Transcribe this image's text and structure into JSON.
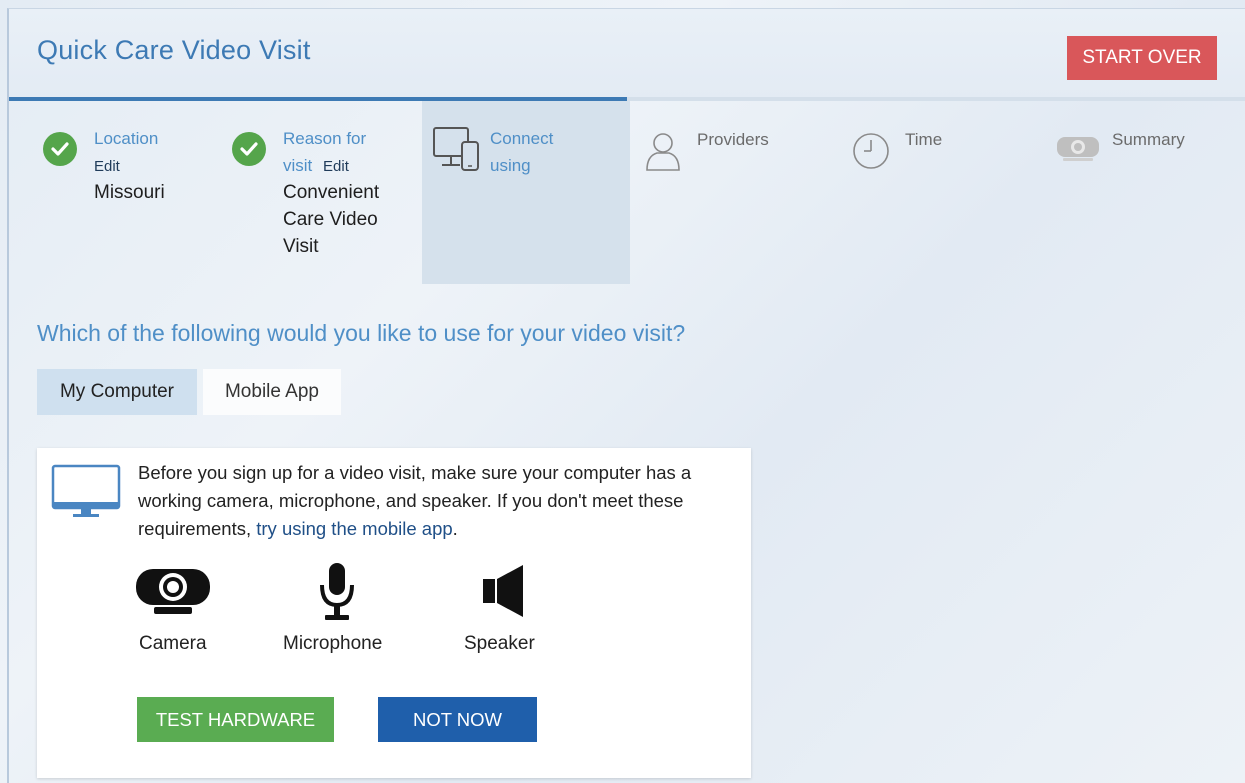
{
  "app": {
    "title": "Quick Care Video Visit",
    "start_over_label": "START OVER"
  },
  "progress": {
    "completed_fraction": 0.5
  },
  "steps": [
    {
      "title": "Location",
      "edit": "Edit",
      "value": "Missouri",
      "status": "complete",
      "icon": "check-icon"
    },
    {
      "title_line1": "Reason for",
      "title_line2": "visit",
      "edit": "Edit",
      "value_lines": [
        "Convenient",
        "Care Video",
        "Visit"
      ],
      "status": "complete",
      "icon": "check-icon"
    },
    {
      "title_line1": "Connect",
      "title_line2": "using",
      "status": "active",
      "icon": "devices-icon"
    },
    {
      "title": "Providers",
      "status": "pending",
      "icon": "person-icon"
    },
    {
      "title": "Time",
      "status": "pending",
      "icon": "clock-icon"
    },
    {
      "title": "Summary",
      "status": "pending",
      "icon": "camera-icon"
    }
  ],
  "question": "Which of the following would you like to use for your video visit?",
  "tabs": [
    {
      "label": "My Computer",
      "selected": true
    },
    {
      "label": "Mobile App",
      "selected": false
    }
  ],
  "card": {
    "text_before_link": "Before you sign up for a video visit, make sure your computer has a working camera, microphone, and speaker. If you don't meet these requirements,",
    "link_text": "try using the mobile app",
    "text_after_link": ".",
    "hardware": [
      {
        "label": "Camera",
        "icon": "webcam-icon"
      },
      {
        "label": "Microphone",
        "icon": "microphone-icon"
      },
      {
        "label": "Speaker",
        "icon": "speaker-icon"
      }
    ],
    "test_button_label": "TEST HARDWARE",
    "not_now_button_label": "NOT NOW"
  },
  "colors": {
    "accent": "#3d7ab4",
    "danger": "#d9575a",
    "success": "#5aac52",
    "primary": "#1f5fab",
    "check": "#55a54b"
  }
}
